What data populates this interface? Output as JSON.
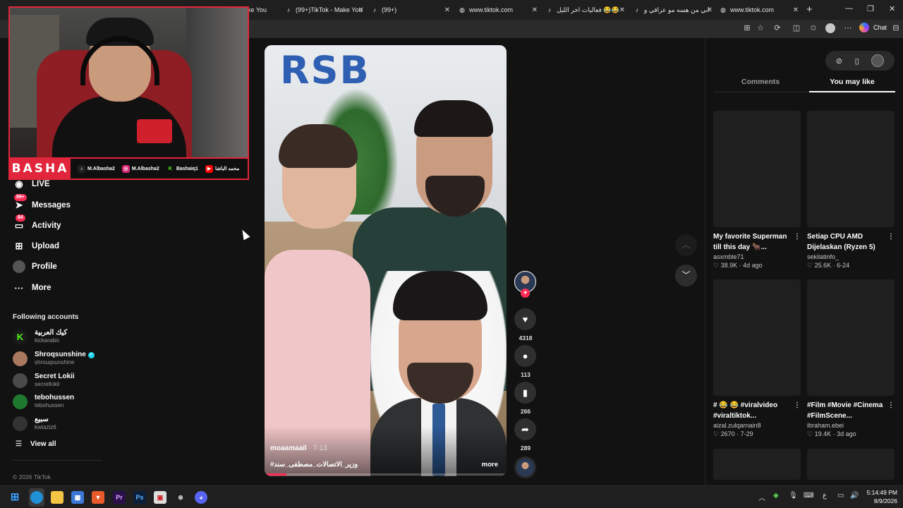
{
  "browser": {
    "tabs": [
      {
        "title": "",
        "icon": "tiktok-icon"
      },
      {
        "title": "(99+)TikTok - Make You",
        "icon": "tiktok-icon"
      },
      {
        "title": "(99+)",
        "icon": "tiktok-icon"
      },
      {
        "title": "www.tiktok.com",
        "icon": "globe-icon"
      },
      {
        "title": "فعاليات اخر الليل 😂😂",
        "icon": "tiktok-icon"
      },
      {
        "title": "اني من هسه مو عراقي و",
        "icon": "tiktok-icon"
      },
      {
        "title": "www.tiktok.com",
        "icon": "globe-icon"
      }
    ],
    "partial_tab_title": "ake You",
    "chat_label": "Chat"
  },
  "webcam": {
    "brand": "BASHA",
    "socials": [
      {
        "icon": "tiktok-icon",
        "handle": "M.Albasha2",
        "color": "#222222"
      },
      {
        "icon": "instagram-icon",
        "handle": "M.Albasha2",
        "color": "#d62976"
      },
      {
        "icon": "kick-icon",
        "handle": "Bashaiq1",
        "color": "#53fc18"
      },
      {
        "icon": "youtube-icon",
        "handle": "محمد الباشا",
        "color": "#ff0000"
      }
    ]
  },
  "sidebar": {
    "nav": [
      {
        "label": "LIVE",
        "icon": "live-icon",
        "badge": ""
      },
      {
        "label": "Messages",
        "icon": "messages-icon",
        "badge": "99+"
      },
      {
        "label": "Activity",
        "icon": "activity-icon",
        "badge": "84"
      },
      {
        "label": "Upload",
        "icon": "upload-icon",
        "badge": ""
      },
      {
        "label": "Profile",
        "icon": "profile-icon",
        "badge": ""
      },
      {
        "label": "More",
        "icon": "more-icon",
        "badge": ""
      }
    ],
    "following_title": "Following accounts",
    "following": [
      {
        "name": "كيك العربية",
        "handle": "kickarabic",
        "verified": false,
        "color": "#1a1a1a"
      },
      {
        "name": "Shroqsunshine",
        "handle": "shrouqsunshine",
        "verified": true,
        "color": "#a9795f"
      },
      {
        "name": "Secret Lokii",
        "handle": "secretlokii",
        "verified": false,
        "color": "#4a4a4a"
      },
      {
        "name": "tebohussen",
        "handle": "tebohussen",
        "verified": false,
        "color": "#1f7a2f"
      },
      {
        "name": "سبيع",
        "handle": "kwtaziz6",
        "verified": false,
        "color": "#333333"
      }
    ],
    "view_all": "View all",
    "copyright": "© 2026 TikTok"
  },
  "video": {
    "author": "moaamaail",
    "date": " · 7-13",
    "caption": "#وزير_الاتصالات_مصطفى_سند",
    "more": "more",
    "progress_percent": 9,
    "logo_text": "RSB"
  },
  "actions": {
    "likes": "4318",
    "comments": "113",
    "saves": "266",
    "shares": "289"
  },
  "right_panel": {
    "tabs": [
      "Comments",
      "You may like"
    ],
    "active_tab": "You may like",
    "cards": [
      {
        "title": "My favorite Superman till this day 🐂...",
        "author": "asxmble71",
        "likes": "38.9K",
        "age": "4d ago"
      },
      {
        "title": "Setiap CPU AMD Dijelaskan (Ryzen 5)",
        "author": "sekilatinfo_",
        "likes": "25.6K",
        "age": "6-24"
      },
      {
        "title": "# 😂 😂 #viralvideo #viraltiktok...",
        "author": "aizal.zulqarnain8",
        "likes": "2670",
        "age": "7-29"
      },
      {
        "title": "#Film #Movie #Cinema #FilmScene...",
        "author": "ibraham.ebei",
        "likes": "19.4K",
        "age": "3d ago"
      }
    ]
  },
  "taskbar": {
    "language": "ع",
    "time": "5:14:49 PM",
    "date": "8/9/2026"
  }
}
